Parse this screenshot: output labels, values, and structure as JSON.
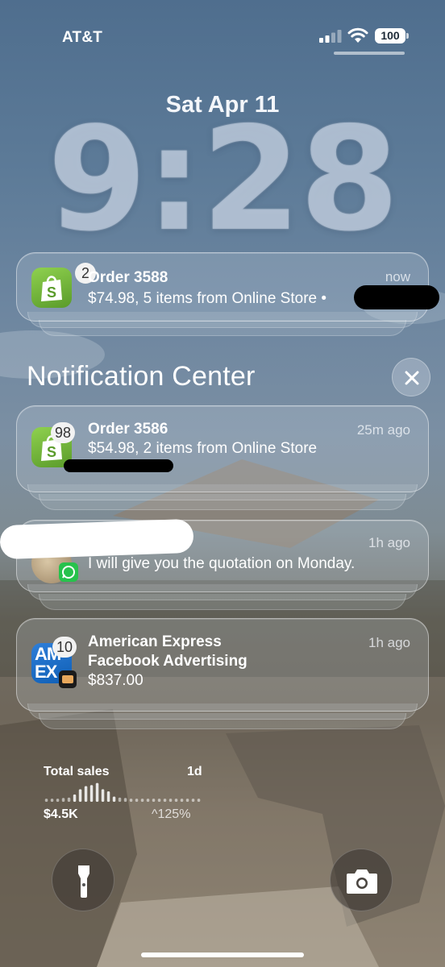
{
  "status_bar": {
    "carrier": "AT&T",
    "battery": "100",
    "signal_icon": "cellular-signal-icon",
    "wifi_icon": "wifi-icon"
  },
  "lock_screen": {
    "date": "Sat Apr 11",
    "time": "9:28"
  },
  "pinned_notification": {
    "app_icon": "shopify-icon",
    "badge": "2",
    "title": "Order 3588",
    "time": "now",
    "body": "$74.98, 5 items from Online Store •"
  },
  "notification_center": {
    "title": "Notification Center",
    "close_icon": "close-icon",
    "notifications": [
      {
        "app_icon": "shopify-icon",
        "badge": "98",
        "title": "Order 3586",
        "time": "25m ago",
        "body": "$54.98, 2 items from Online Store"
      },
      {
        "app_icon": "whatsapp-icon",
        "time": "1h ago",
        "body": "I will give you the quotation on Monday."
      },
      {
        "app_icon": "amex-icon",
        "badge": "10",
        "title": "American Express",
        "subtitle": "Facebook Advertising",
        "body": "$837.00",
        "time": "1h ago",
        "icon_text": "AM EX"
      }
    ]
  },
  "sales_widget": {
    "label": "Total sales",
    "period": "1d",
    "value": "$4.5K",
    "change": "^125%",
    "sparkline": [
      0.15,
      0.15,
      0.15,
      0.18,
      0.2,
      0.35,
      0.6,
      0.75,
      0.8,
      0.9,
      0.6,
      0.5,
      0.25,
      0.2,
      0.18,
      0.15,
      0.15,
      0.15,
      0.15,
      0.15,
      0.15,
      0.15,
      0.15,
      0.15,
      0.15,
      0.15,
      0.15,
      0.15
    ]
  },
  "bottom_controls": {
    "flashlight_icon": "flashlight-icon",
    "camera_icon": "camera-icon"
  }
}
